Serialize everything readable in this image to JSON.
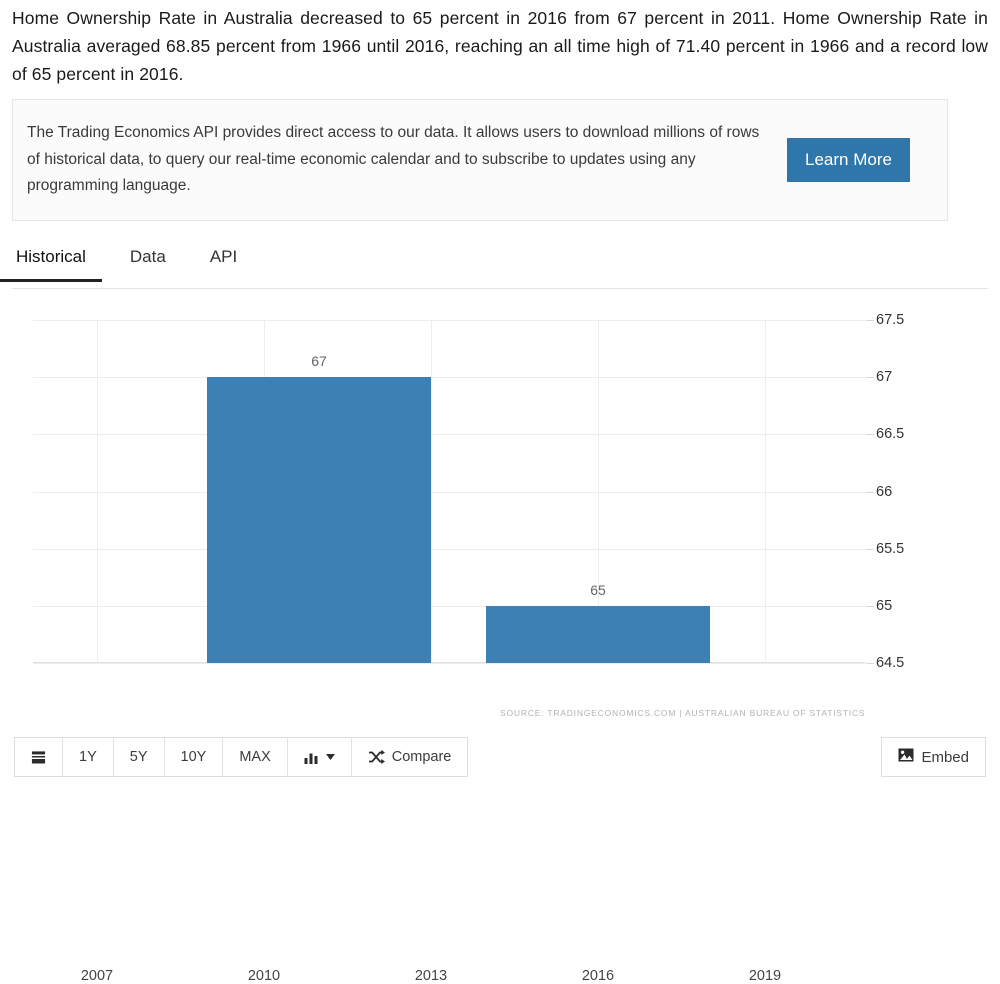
{
  "intro": {
    "text": "Home Ownership Rate in Australia decreased to 65 percent in 2016 from 67 percent in 2011. Home Ownership Rate in Australia averaged 68.85 percent from 1966 until 2016, reaching an all time high of 71.40 percent in 1966 and a record low of 65 percent in 2016."
  },
  "api_callout": {
    "text": "The Trading Economics API provides direct access to our data. It allows users to download millions of rows of historical data, to query our real-time economic calendar and to subscribe to updates using any programming language.",
    "button_label": "Learn More",
    "button_color": "#2f76ab"
  },
  "tabs": [
    {
      "label": "Historical",
      "active": true
    },
    {
      "label": "Data",
      "active": false
    },
    {
      "label": "API",
      "active": false
    }
  ],
  "chart_data": {
    "type": "bar",
    "title": "",
    "xlabel": "",
    "ylabel": "",
    "categories": [
      "2011",
      "2016"
    ],
    "values": [
      67,
      65
    ],
    "data_labels": [
      "67",
      "65"
    ],
    "bar_color": "#3d80b3",
    "ylim": [
      64.5,
      67.5
    ],
    "ytick_labels": [
      "67.5",
      "67",
      "66.5",
      "66",
      "65.5",
      "65",
      "64.5"
    ],
    "ytick_values": [
      67.5,
      67,
      66.5,
      66,
      65.5,
      65,
      64.5
    ],
    "xtick_labels": [
      "2007",
      "2010",
      "2013",
      "2016",
      "2019"
    ],
    "grid": true,
    "legend": "none",
    "source": "SOURCE: TRADINGECONOMICS.COM  |  AUSTRALIAN BUREAU OF STATISTICS"
  },
  "toolbar": {
    "list_icon": "list-icon",
    "ranges": [
      "1Y",
      "5Y",
      "10Y",
      "MAX"
    ],
    "chart_type_icon": "bar-chart-icon",
    "chart_type_caret": "chevron-down-icon",
    "compare_icon": "shuffle-icon",
    "compare_label": "Compare",
    "embed_icon": "image-icon",
    "embed_label": "Embed"
  }
}
